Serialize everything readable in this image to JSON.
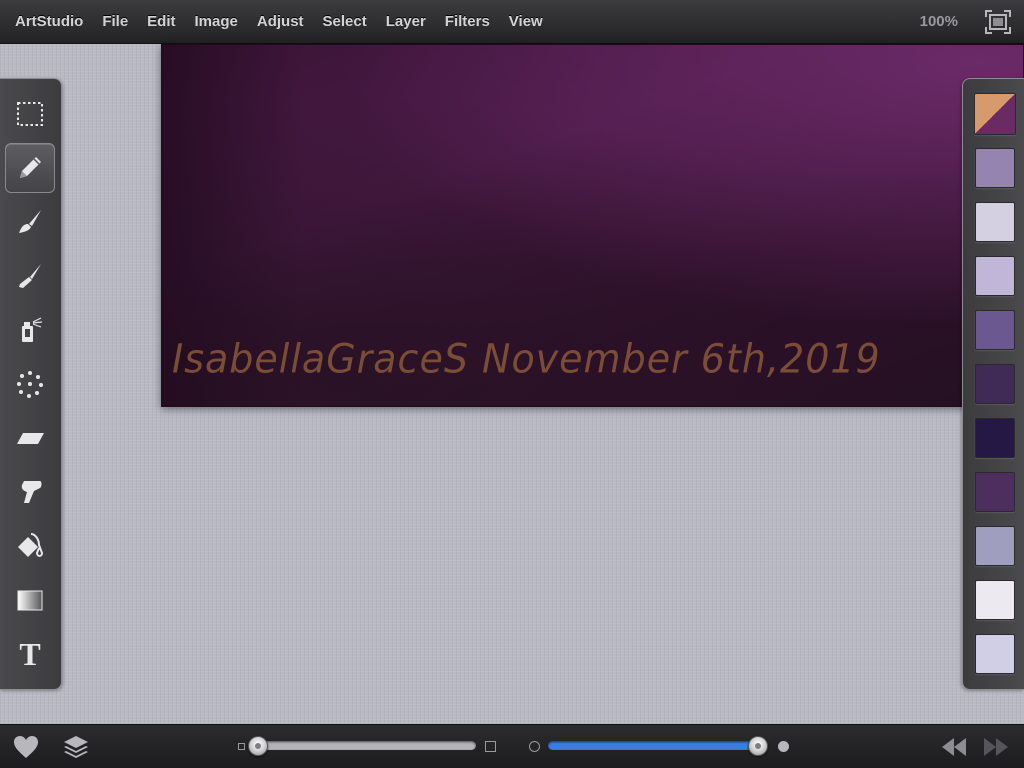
{
  "app": {
    "name": "ArtStudio"
  },
  "menubar": {
    "items": [
      "ArtStudio",
      "File",
      "Edit",
      "Image",
      "Adjust",
      "Select",
      "Layer",
      "Filters",
      "View"
    ],
    "zoom": "100%",
    "fullscreen_icon": "fullscreen-icon"
  },
  "canvas": {
    "signature_text": "IsabellaGraceS  November 6th,2019"
  },
  "tools": [
    {
      "name": "selection-tool",
      "icon": "dotted-rect-icon",
      "selected": false
    },
    {
      "name": "pencil-tool",
      "icon": "pencil-icon",
      "selected": true
    },
    {
      "name": "brush-tool",
      "icon": "brush-icon",
      "selected": false
    },
    {
      "name": "fine-brush-tool",
      "icon": "fine-brush-icon",
      "selected": false
    },
    {
      "name": "airbrush-tool",
      "icon": "spray-can-icon",
      "selected": false
    },
    {
      "name": "scatter-tool",
      "icon": "dots-circle-icon",
      "selected": false
    },
    {
      "name": "eraser-tool",
      "icon": "eraser-icon",
      "selected": false
    },
    {
      "name": "smudge-tool",
      "icon": "smudge-icon",
      "selected": false
    },
    {
      "name": "fill-tool",
      "icon": "paint-bucket-icon",
      "selected": false
    },
    {
      "name": "gradient-tool",
      "icon": "gradient-icon",
      "selected": false
    },
    {
      "name": "text-tool",
      "icon": "text-icon",
      "selected": false
    }
  ],
  "text_tool_glyph": "T",
  "palette": {
    "current": {
      "primary": "#d69a6c",
      "secondary": "#6a2a63"
    },
    "swatches": [
      "#9684b0",
      "#d5d0e1",
      "#c1b5d8",
      "#6b5890",
      "#3f2b55",
      "#261845",
      "#4e2e5f",
      "#a09ebe",
      "#ece9f1",
      "#d1cfe5"
    ]
  },
  "bottombar": {
    "favorite_icon": "heart-icon",
    "layers_icon": "layers-icon",
    "size_slider": {
      "value": 0.0
    },
    "opacity_slider": {
      "value": 1.0
    },
    "undo_icon": "rewind-icon",
    "redo_icon": "fast-forward-icon"
  },
  "colors": {
    "menu_text": "#d4d4d6",
    "zoom_text": "#9a9a9e",
    "slider_blue": "#3a7de0",
    "slider_gray": "#b4b4b8"
  }
}
